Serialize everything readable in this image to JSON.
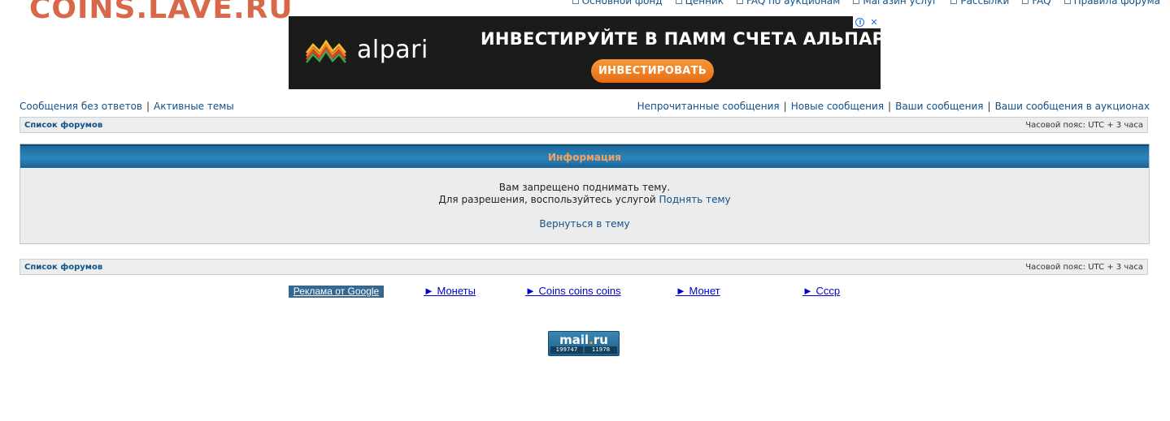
{
  "site": {
    "logo_text": "COINS.LAVE.RU"
  },
  "top_nav": [
    {
      "label": "Основной фонд"
    },
    {
      "label": "Ценник"
    },
    {
      "label": "FAQ по аукционам"
    },
    {
      "label": "Магазин услуг"
    },
    {
      "label": "Рассылки"
    },
    {
      "label": "FAQ"
    },
    {
      "label": "Правила форума"
    }
  ],
  "banner": {
    "brand": "alpari",
    "headline": "ИНВЕСТИРУЙТЕ В ПАММ СЧЕТА АЛЬПАРИ",
    "cta": "ИНВЕСТИРОВАТЬ",
    "adchoice_info": "i",
    "adchoice_close": "✕"
  },
  "quick_links": {
    "left": [
      "Сообщения без ответов",
      "Активные темы"
    ],
    "right": [
      "Непрочитанные сообщения",
      "Новые сообщения",
      "Ваши сообщения",
      "Ваши сообщения в аукционах"
    ],
    "separator": "|"
  },
  "navbar": {
    "forum_list": "Список форумов",
    "timezone": "Часовой пояс: UTC + 3 часа"
  },
  "info": {
    "title": "Информация",
    "line1": "Вам запрещено поднимать тему.",
    "line2_prefix": "Для разрешения, воспользуйтесь услугой",
    "line2_link": "Поднять тему",
    "return_link": "Вернуться в тему"
  },
  "google_ads": {
    "label": "Реклама от Google",
    "links": [
      "► Монеты",
      "► Coins coins coins",
      "► Монет",
      "► Ссср"
    ]
  },
  "counter": {
    "brand_main": "mail",
    "brand_dot": ".",
    "brand_tld": "ru",
    "value1": "199747",
    "value2": "11978"
  },
  "colors": {
    "logo": "#d9684a",
    "link": "#105289",
    "panel_header": "#2b86bc",
    "panel_title": "#f5a35c",
    "ad_link": "#0000cc"
  }
}
